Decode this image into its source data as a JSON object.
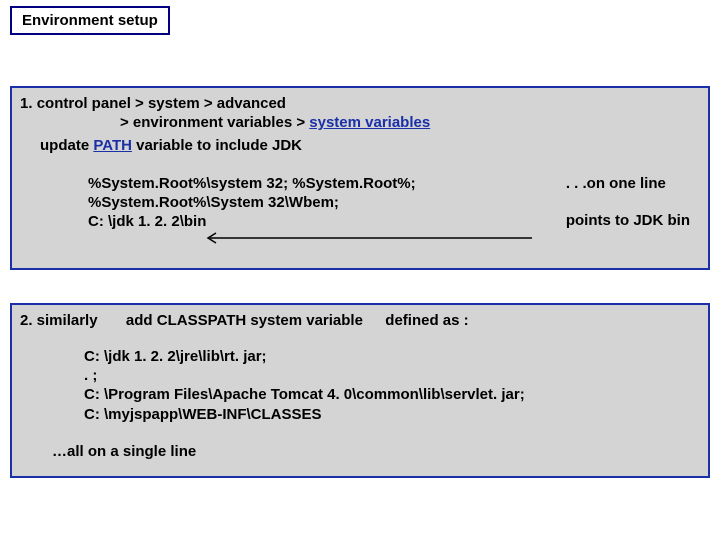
{
  "title": "Environment setup",
  "box1": {
    "prefix": "1. ",
    "nav1": "control panel > system > advanced",
    "nav2_pre": "> environment variables > ",
    "nav2_link": "system variables",
    "update_pre": "update ",
    "update_link": "PATH",
    "update_post": " variable to include JDK",
    "path_l1": "%System.Root%\\system 32; %System.Root%;",
    "path_l2": "%System.Root%\\System 32\\Wbem;",
    "path_l3": "C: \\jdk 1. 2. 2\\bin",
    "note_l1": ". . .on one line",
    "note_l2": "points to JDK bin"
  },
  "box2": {
    "prefix": "2. similarly",
    "mid": "add CLASSPATH system variable",
    "suffix": "defined as :",
    "cp_l1": "C: \\jdk 1. 2. 2\\jre\\lib\\rt. jar;",
    "cp_l2": ". ;",
    "cp_l3": "C: \\Program Files\\Apache Tomcat 4. 0\\common\\lib\\servlet. jar;",
    "cp_l4": "C: \\myjspapp\\WEB-INF\\CLASSES",
    "allline": "…all on a single line"
  }
}
